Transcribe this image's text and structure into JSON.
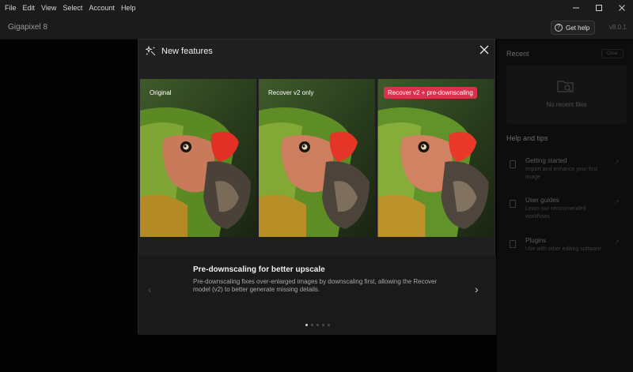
{
  "menu": [
    "File",
    "Edit",
    "View",
    "Select",
    "Account",
    "Help"
  ],
  "app": {
    "name": "Gigapixel 8",
    "help_label": "Get help",
    "version": "v8.0.1"
  },
  "sidebar": {
    "recent_title": "Recent",
    "clear_label": "Clear",
    "no_recent": "No recent files",
    "help_title": "Help and tips",
    "tips": [
      {
        "title": "Getting started",
        "desc": "Import and enhance your first image"
      },
      {
        "title": "User guides",
        "desc": "Learn our recommended workflows"
      },
      {
        "title": "Plugins",
        "desc": "Use with other editing software"
      }
    ]
  },
  "modal": {
    "title": "New features",
    "panels": [
      {
        "label": "Original"
      },
      {
        "label": "Recover v2 only"
      },
      {
        "label": "Recover v2 + pre-downscaling"
      }
    ],
    "feature_title": "Pre-downscaling for better upscale",
    "feature_desc": "Pre-downscaling fixes over-enlarged images by downscaling first, allowing the Recover model (v2) to better generate missing details.",
    "page_count": 5,
    "active_page": 1
  },
  "colors": {
    "accent": "#d8324e",
    "modal_bg": "#1f1f1f",
    "window_bg": "#1b1b1b"
  }
}
